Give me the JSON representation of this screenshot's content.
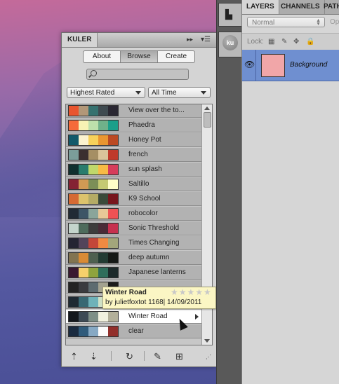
{
  "kuler": {
    "title": "KULER",
    "collapse_icon": "double-chevron-right",
    "menu_icon": "panel-menu",
    "tabs": [
      "About",
      "Browse",
      "Create"
    ],
    "active_tab": "Browse",
    "search_placeholder": "",
    "filter_sort": "Highest Rated",
    "filter_time": "All Time",
    "themes": [
      {
        "name": "View over the to...",
        "colors": [
          "#e8552f",
          "#b29778",
          "#36716f",
          "#3f4a50",
          "#2a2732"
        ]
      },
      {
        "name": "Phaedra",
        "colors": [
          "#f56b3a",
          "#f8f3b4",
          "#bde0ab",
          "#6fb18a",
          "#1b9f8a"
        ]
      },
      {
        "name": "Honey Pot",
        "colors": [
          "#12596a",
          "#fbf3cf",
          "#f6d15b",
          "#e99631",
          "#bb4a23"
        ]
      },
      {
        "name": "french",
        "colors": [
          "#7b9d9a",
          "#3a2f2f",
          "#a58f64",
          "#dac49a",
          "#bf3a2b"
        ]
      },
      {
        "name": "sun splash",
        "colors": [
          "#11302f",
          "#2a7c6d",
          "#bfd86b",
          "#f7bb45",
          "#d63d5b"
        ]
      },
      {
        "name": "Saltillo",
        "colors": [
          "#852233",
          "#d09a54",
          "#7c8f57",
          "#c5c972",
          "#fffec8"
        ]
      },
      {
        "name": "K9 School",
        "colors": [
          "#d56a33",
          "#dcc36c",
          "#b4ab65",
          "#3a4a3a",
          "#77161d"
        ]
      },
      {
        "name": "robocolor",
        "colors": [
          "#212a35",
          "#3d5566",
          "#8aa59a",
          "#e8c797",
          "#ef5254"
        ]
      },
      {
        "name": "Sonic Threshold",
        "colors": [
          "#c4d4cc",
          "#4e6b5c",
          "#3d3c3c",
          "#4a2b37",
          "#c6304e"
        ]
      },
      {
        "name": "Times Changing",
        "colors": [
          "#242433",
          "#53445a",
          "#c34739",
          "#f08a42",
          "#a3a67b"
        ]
      },
      {
        "name": "deep autumn",
        "colors": [
          "#827451",
          "#d98b35",
          "#4e6050",
          "#223b33",
          "#151916"
        ]
      },
      {
        "name": "Japanese lanterns",
        "colors": [
          "#3a1830",
          "#f6d06b",
          "#8ea33e",
          "#2f6e5b",
          "#1c2a2a"
        ]
      },
      {
        "name": "",
        "colors": [
          "#232323",
          "#3a3b3f",
          "#5d6b70",
          "#a3a290",
          "#1c1c1c"
        ]
      },
      {
        "name": "...",
        "colors": [
          "#1e2a33",
          "#386873",
          "#6fb2b9",
          "#cfe0c6",
          "#8b8a6d"
        ]
      },
      {
        "name": "Winter Road",
        "colors": [
          "#13171c",
          "#3d4a55",
          "#7e8f87",
          "#f1f1df",
          "#b3b09a"
        ],
        "selected": true
      },
      {
        "name": "clear",
        "colors": [
          "#1a2b40",
          "#305b7b",
          "#87a9c4",
          "#fbfbfb",
          "#922f2b"
        ]
      }
    ],
    "tooltip": {
      "title": "Winter Road",
      "rating_stars": "★★★★★",
      "meta": "by julietfoxtot  1168| 14/09/2011"
    },
    "bottom_icons": [
      "move-up-icon",
      "move-down-icon",
      "refresh-icon",
      "edit-theme-icon",
      "add-to-swatches-icon"
    ]
  },
  "strip": {
    "kuler_button_label": "ku",
    "top_icon": "book-icon"
  },
  "layers_panel": {
    "tabs": [
      "LAYERS",
      "CHANNELS",
      "PATH"
    ],
    "active_tab": "LAYERS",
    "blend_mode": "Normal",
    "opacity_label": "Op",
    "lock_label": "Lock:",
    "layer": {
      "name": "Background",
      "thumb_color": "#f1a6a8"
    }
  }
}
